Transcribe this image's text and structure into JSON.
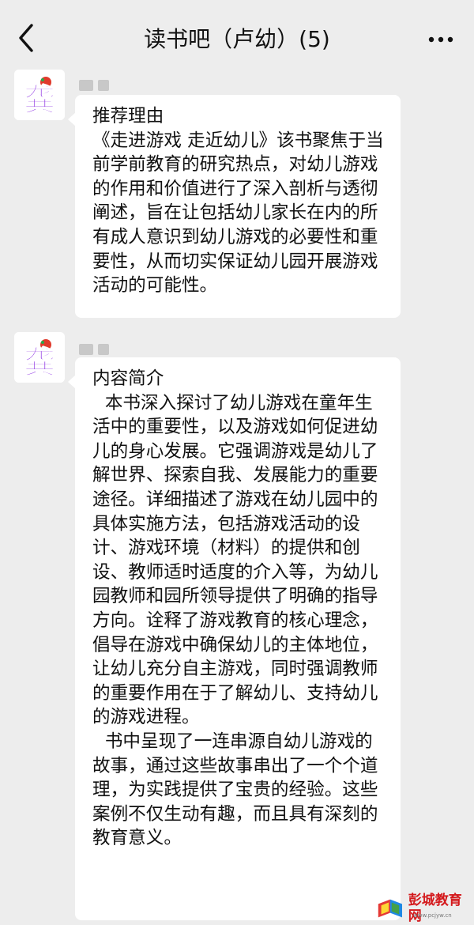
{
  "header": {
    "title": "读书吧（卢幼）(5)",
    "back_icon": "chevron-left-icon",
    "more_icon": "ellipsis-icon"
  },
  "messages": [
    {
      "avatar_glyph": "龚",
      "title": "推荐理由",
      "paragraphs": [
        "《走进游戏 走近幼儿》该书聚焦于当前学前教育的研究热点，对幼儿游戏的作用和价值进行了深入剖析与透彻阐述，旨在让包括幼儿家长在内的所有成人意识到幼儿游戏的必要性和重要性，从而切实保证幼儿园开展游戏活动的可能性。"
      ]
    },
    {
      "avatar_glyph": "龚",
      "title": "内容简介",
      "paragraphs": [
        "本书深入探讨了幼儿游戏在童年生活中的重要性，以及游戏如何促进幼儿的身心发展。它强调游戏是幼儿了解世界、探索自我、发展能力的重要途径。详细描述了游戏在幼儿园中的具体实施方法，包括游戏活动的设计、游戏环境（材料）的提供和创设、教师适时适度的介入等，为幼儿园教师和园所领导提供了明确的指导方向。诠释了游戏教育的核心理念，倡导在游戏中确保幼儿的主体地位，让幼儿充分自主游戏，同时强调教师的重要作用在于了解幼儿、支持幼儿的游戏进程。",
        "书中呈现了一连串源自幼儿游戏的故事，通过这些故事串出了一个个道理，为实践提供了宝贵的经验。这些案例不仅生动有趣，而且具有深刻的教育意义。"
      ]
    }
  ],
  "watermark": {
    "text": "彭城教育网",
    "domain": "www.pcjyw.cn",
    "color": "#d4191c"
  },
  "colors": {
    "background": "#ededed",
    "bubble": "#ffffff",
    "avatar_text": "#8a2be2"
  }
}
